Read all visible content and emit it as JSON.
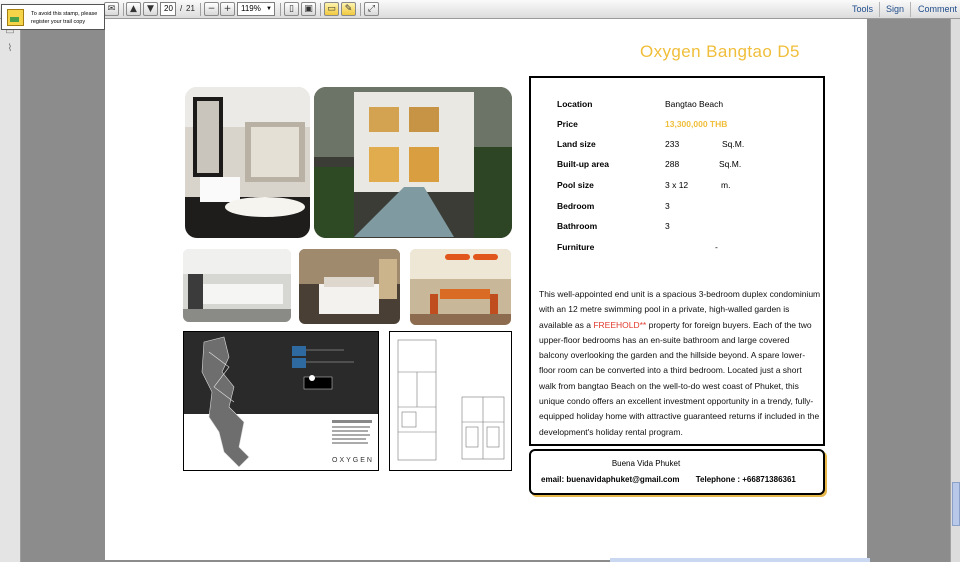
{
  "toolbar": {
    "page_current": "20",
    "page_sep": "/",
    "page_total": "21",
    "zoom": "119%",
    "tools_label": "Tools",
    "sign_label": "Sign",
    "comment_label": "Comment"
  },
  "stamp_notice": {
    "line1": "To avoid this stamp, please",
    "line2": "register your trail copy"
  },
  "document": {
    "title": "Oxygen Bangtao D5",
    "properties": [
      {
        "label": "Location",
        "value": "Bangtao Beach",
        "unit": ""
      },
      {
        "label": "Price",
        "value": "13,300,000 THB",
        "unit": ""
      },
      {
        "label": "Land size",
        "value": "233",
        "unit": "Sq.M."
      },
      {
        "label": "Built-up area",
        "value": "288",
        "unit": "Sq.M."
      },
      {
        "label": "Pool size",
        "value": "3 x 12",
        "unit": "m."
      },
      {
        "label": "Bedroom",
        "value": "3",
        "unit": ""
      },
      {
        "label": "Bathroom",
        "value": "3",
        "unit": ""
      },
      {
        "label": "Furniture",
        "value": "-",
        "unit": ""
      }
    ],
    "description_before": "This well-appointed end unit is a spacious 3-bedroom duplex condominium with an 12 metre swimming pool in a private, high-walled garden is available as a ",
    "description_highlight": "FREEHOLD**",
    "description_after": " property for foreign buyers. Each of the two upper-floor bedrooms has an en-suite bathroom and large covered balcony overlooking the garden and the hillside beyond. A spare lower-floor room can be converted into a third bedroom. Located just a short walk from bangtao Beach  on the well-to-do west coast of Phuket, this unique condo offers an excellent investment opportunity in a trendy, fully-equipped holiday home with attractive guaranteed returns if included in the development's holiday rental program.",
    "contact": {
      "company": "Buena Vida Phuket",
      "email": "email: buenavidaphuket@gmail.com",
      "telephone": "Telephone : +66871386361"
    },
    "map_brand": "OXYGEN"
  },
  "colors": {
    "title": "#f0be3a",
    "price": "#f0be3a",
    "freehold": "#e03a2e",
    "link": "#1f4c8c"
  },
  "icons": [
    "stamp-icon",
    "hand-icon",
    "page-up-icon",
    "page-down-icon",
    "zoom-out-icon",
    "zoom-in-icon",
    "fit-page-icon",
    "fit-width-icon",
    "comment-icon",
    "highlight-icon",
    "expand-icon",
    "attachment-icon"
  ]
}
